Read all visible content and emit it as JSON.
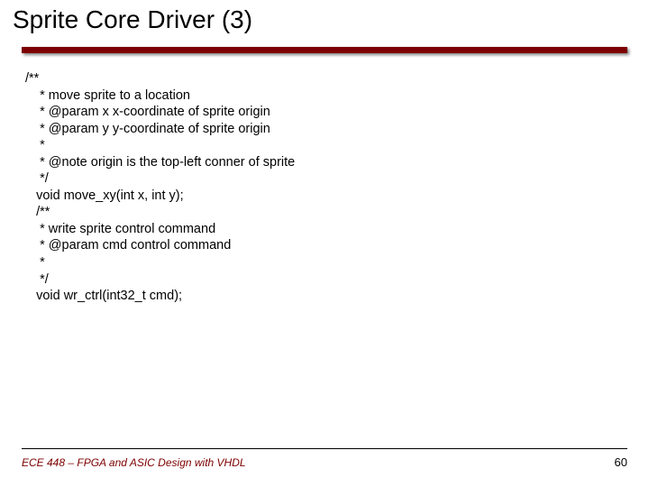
{
  "title": "Sprite Core Driver (3)",
  "code": {
    "l01": "/**",
    "l02": "    * move sprite to a location",
    "l03": "    * @param x x-coordinate of sprite origin",
    "l04": "    * @param y y-coordinate of sprite origin",
    "l05": "    *",
    "l06": "    * @note origin is the top-left conner of sprite",
    "l07": "    */",
    "l08": "",
    "l09": "   void move_xy(int x, int y);",
    "l10": "   /**",
    "l11": "    * write sprite control command",
    "l12": "    * @param cmd control command",
    "l13": "    *",
    "l14": "    */",
    "l15": "   void wr_ctrl(int32_t cmd);"
  },
  "footer": {
    "left": "ECE 448 – FPGA and ASIC Design with VHDL",
    "right": "60"
  }
}
